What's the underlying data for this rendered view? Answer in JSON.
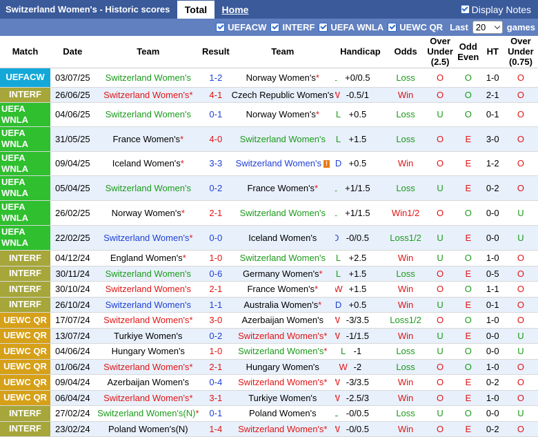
{
  "header": {
    "title": "Switzerland Women's - Historic scores",
    "tab_total": "Total",
    "tab_home": "Home",
    "display_notes": "Display Notes"
  },
  "filters": {
    "items": [
      "UEFACW",
      "INTERF",
      "UEFA WNLA",
      "UEWC QR"
    ],
    "last_label": "Last",
    "last_value": "20",
    "games_label": "games"
  },
  "columns": {
    "match": "Match",
    "date": "Date",
    "team1": "Team",
    "result": "Result",
    "team2": "Team",
    "handicap": "Handicap",
    "odds": "Odds",
    "over_under": "Over Under (2.5)",
    "odd_even": "Odd Even",
    "ht": "HT",
    "over_under2": "Over Under (0.75)"
  },
  "colors": {
    "accent": "#3a5a9a",
    "filterbar": "#6080c0",
    "row_alt": "#e8f0fb",
    "uefacw": "#14a8d8",
    "interf": "#a6a63a",
    "wnla": "#2fbf2f",
    "uewc": "#d6a018"
  },
  "rows": [
    {
      "comp": "UEFACW",
      "cc": "UEFACW",
      "h": 28,
      "date": "03/07/25",
      "t1": "Switzerland Women's",
      "t1c": "green",
      "t1s": "",
      "score": "1-2",
      "sc": "blue",
      "t2": "Norway Women's",
      "t2c": "black",
      "t2s": "*",
      "res": "L",
      "hc": "+0/0.5",
      "odds": "Loss",
      "ou": "O",
      "oe": "O",
      "ht": "1-0",
      "ou2": "O"
    },
    {
      "comp": "INTERF",
      "cc": "INTERF",
      "h": 22,
      "date": "26/06/25",
      "t1": "Switzerland Women's",
      "t1c": "red",
      "t1s": "*",
      "score": "4-1",
      "sc": "red",
      "t2": "Czech Republic Women's",
      "t2c": "black",
      "t2s": "",
      "res": "W",
      "hc": "-0.5/1",
      "odds": "Win",
      "ou": "O",
      "oe": "O",
      "ht": "2-1",
      "ou2": "O"
    },
    {
      "comp": "UEFA WNLA",
      "cc": "WNLA",
      "h": 35,
      "date": "04/06/25",
      "t1": "Switzerland Women's",
      "t1c": "green",
      "t1s": "",
      "score": "0-1",
      "sc": "blue",
      "t2": "Norway Women's",
      "t2c": "black",
      "t2s": "*",
      "res": "L",
      "hc": "+0.5",
      "odds": "Loss",
      "ou": "U",
      "oe": "O",
      "ht": "0-1",
      "ou2": "O"
    },
    {
      "comp": "UEFA WNLA",
      "cc": "WNLA",
      "h": 36,
      "date": "31/05/25",
      "t1": "France Women's",
      "t1c": "black",
      "t1s": "*",
      "score": "4-0",
      "sc": "red",
      "t2": "Switzerland Women's",
      "t2c": "green",
      "t2s": "",
      "res": "L",
      "hc": "+1.5",
      "odds": "Loss",
      "ou": "O",
      "oe": "E",
      "ht": "3-0",
      "ou2": "O"
    },
    {
      "comp": "UEFA WNLA",
      "cc": "WNLA",
      "h": 35,
      "date": "09/04/25",
      "t1": "Iceland Women's",
      "t1c": "black",
      "t1s": "*",
      "score": "3-3",
      "sc": "blue",
      "t2": "Switzerland Women's",
      "t2c": "blue",
      "t2s": "!",
      "res": "D",
      "hc": "+0.5",
      "odds": "Win",
      "ou": "O",
      "oe": "E",
      "ht": "1-2",
      "ou2": "O"
    },
    {
      "comp": "UEFA WNLA",
      "cc": "WNLA",
      "h": 36,
      "date": "05/04/25",
      "t1": "Switzerland Women's",
      "t1c": "green",
      "t1s": "",
      "score": "0-2",
      "sc": "blue",
      "t2": "France Women's",
      "t2c": "black",
      "t2s": "*",
      "res": "L",
      "hc": "+1/1.5",
      "odds": "Loss",
      "ou": "U",
      "oe": "E",
      "ht": "0-2",
      "ou2": "O"
    },
    {
      "comp": "UEFA WNLA",
      "cc": "WNLA",
      "h": 36,
      "date": "26/02/25",
      "t1": "Norway Women's",
      "t1c": "black",
      "t1s": "*",
      "score": "2-1",
      "sc": "red",
      "t2": "Switzerland Women's",
      "t2c": "green",
      "t2s": "",
      "res": "L",
      "hc": "+1/1.5",
      "odds": "Win1/2",
      "ou": "O",
      "oe": "O",
      "ht": "0-0",
      "ou2": "U"
    },
    {
      "comp": "UEFA WNLA",
      "cc": "WNLA",
      "h": 36,
      "date": "22/02/25",
      "t1": "Switzerland Women's",
      "t1c": "blue",
      "t1s": "*",
      "score": "0-0",
      "sc": "blue",
      "t2": "Iceland Women's",
      "t2c": "black",
      "t2s": "",
      "res": "D",
      "hc": "-0/0.5",
      "odds": "Loss1/2",
      "ou": "U",
      "oe": "E",
      "ht": "0-0",
      "ou2": "U"
    },
    {
      "comp": "INTERF",
      "cc": "INTERF",
      "h": 23,
      "date": "04/12/24",
      "t1": "England Women's",
      "t1c": "black",
      "t1s": "*",
      "score": "1-0",
      "sc": "red",
      "t2": "Switzerland Women's",
      "t2c": "green",
      "t2s": "",
      "res": "L",
      "hc": "+2.5",
      "odds": "Win",
      "ou": "U",
      "oe": "O",
      "ht": "1-0",
      "ou2": "O"
    },
    {
      "comp": "INTERF",
      "cc": "INTERF",
      "h": 22,
      "date": "30/11/24",
      "t1": "Switzerland Women's",
      "t1c": "green",
      "t1s": "",
      "score": "0-6",
      "sc": "blue",
      "t2": "Germany Women's",
      "t2c": "black",
      "t2s": "*",
      "res": "L",
      "hc": "+1.5",
      "odds": "Loss",
      "ou": "O",
      "oe": "E",
      "ht": "0-5",
      "ou2": "O"
    },
    {
      "comp": "INTERF",
      "cc": "INTERF",
      "h": 23,
      "date": "30/10/24",
      "t1": "Switzerland Women's",
      "t1c": "red",
      "t1s": "",
      "score": "2-1",
      "sc": "red",
      "t2": "France Women's",
      "t2c": "black",
      "t2s": "*",
      "res": "W",
      "hc": "+1.5",
      "odds": "Win",
      "ou": "O",
      "oe": "O",
      "ht": "1-1",
      "ou2": "O"
    },
    {
      "comp": "INTERF",
      "cc": "INTERF",
      "h": 22,
      "date": "26/10/24",
      "t1": "Switzerland Women's",
      "t1c": "blue",
      "t1s": "",
      "score": "1-1",
      "sc": "blue",
      "t2": "Australia Women's",
      "t2c": "black",
      "t2s": "*",
      "res": "D",
      "hc": "+0.5",
      "odds": "Win",
      "ou": "U",
      "oe": "E",
      "ht": "0-1",
      "ou2": "O"
    },
    {
      "comp": "UEWC QR",
      "cc": "UEWC",
      "h": 23,
      "date": "17/07/24",
      "t1": "Switzerland Women's",
      "t1c": "red",
      "t1s": "*",
      "score": "3-0",
      "sc": "red",
      "t2": "Azerbaijan Women's",
      "t2c": "black",
      "t2s": "",
      "res": "W",
      "hc": "-3/3.5",
      "odds": "Loss1/2",
      "ou": "O",
      "oe": "O",
      "ht": "1-0",
      "ou2": "O"
    },
    {
      "comp": "UEWC QR",
      "cc": "UEWC",
      "h": 22,
      "date": "13/07/24",
      "t1": "Turkiye Women's",
      "t1c": "black",
      "t1s": "",
      "score": "0-2",
      "sc": "blue",
      "t2": "Switzerland Women's",
      "t2c": "red",
      "t2s": "*",
      "res": "W",
      "hc": "-1/1.5",
      "odds": "Win",
      "ou": "U",
      "oe": "E",
      "ht": "0-0",
      "ou2": "U"
    },
    {
      "comp": "UEWC QR",
      "cc": "UEWC",
      "h": 23,
      "date": "04/06/24",
      "t1": "Hungary Women's",
      "t1c": "black",
      "t1s": "",
      "score": "1-0",
      "sc": "red",
      "t2": "Switzerland Women's",
      "t2c": "green",
      "t2s": "*",
      "res": "L",
      "hc": "-1",
      "odds": "Loss",
      "ou": "U",
      "oe": "O",
      "ht": "0-0",
      "ou2": "U"
    },
    {
      "comp": "UEWC QR",
      "cc": "UEWC",
      "h": 22,
      "date": "01/06/24",
      "t1": "Switzerland Women's",
      "t1c": "red",
      "t1s": "*",
      "score": "2-1",
      "sc": "red",
      "t2": "Hungary Women's",
      "t2c": "black",
      "t2s": "",
      "res": "W",
      "hc": "-2",
      "odds": "Loss",
      "ou": "O",
      "oe": "O",
      "ht": "1-0",
      "ou2": "O"
    },
    {
      "comp": "UEWC QR",
      "cc": "UEWC",
      "h": 23,
      "date": "09/04/24",
      "t1": "Azerbaijan Women's",
      "t1c": "black",
      "t1s": "",
      "score": "0-4",
      "sc": "blue",
      "t2": "Switzerland Women's",
      "t2c": "red",
      "t2s": "*",
      "res": "W",
      "hc": "-3/3.5",
      "odds": "Win",
      "ou": "O",
      "oe": "E",
      "ht": "0-2",
      "ou2": "O"
    },
    {
      "comp": "UEWC QR",
      "cc": "UEWC",
      "h": 22,
      "date": "06/04/24",
      "t1": "Switzerland Women's",
      "t1c": "red",
      "t1s": "*",
      "score": "3-1",
      "sc": "red",
      "t2": "Turkiye Women's",
      "t2c": "black",
      "t2s": "",
      "res": "W",
      "hc": "-2.5/3",
      "odds": "Win",
      "ou": "O",
      "oe": "E",
      "ht": "1-0",
      "ou2": "O"
    },
    {
      "comp": "INTERF",
      "cc": "INTERF",
      "h": 23,
      "date": "27/02/24",
      "t1": "Switzerland Women's(N)",
      "t1c": "green",
      "t1s": "*",
      "score": "0-1",
      "sc": "blue",
      "t2": "Poland Women's",
      "t2c": "black",
      "t2s": "",
      "res": "L",
      "hc": "-0/0.5",
      "odds": "Loss",
      "ou": "U",
      "oe": "O",
      "ht": "0-0",
      "ou2": "U"
    },
    {
      "comp": "INTERF",
      "cc": "INTERF",
      "h": 22,
      "date": "23/02/24",
      "t1": "Poland Women's(N)",
      "t1c": "black",
      "t1s": "",
      "score": "1-4",
      "sc": "red",
      "t2": "Switzerland Women's",
      "t2c": "red",
      "t2s": "*",
      "res": "W",
      "hc": "-0/0.5",
      "odds": "Win",
      "ou": "O",
      "oe": "E",
      "ht": "0-2",
      "ou2": "O"
    }
  ]
}
